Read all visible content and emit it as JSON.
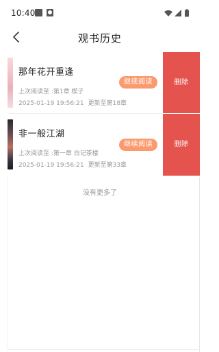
{
  "status_bar": {
    "time": "10:40"
  },
  "header": {
    "title": "观书历史"
  },
  "history": [
    {
      "title": "那年花开重逢",
      "last_read": "上次阅读至 :第1章  楔子",
      "time": "2025-01-19 19:56:21",
      "update": "更新至第18章",
      "continue_label": "继续阅读",
      "delete_label": "删除"
    },
    {
      "title": "非一般江湖",
      "last_read": "上次阅读至 :第一章  白记茶楼",
      "time": "2025-01-19 19:56:21",
      "update": "更新至第33章",
      "continue_label": "继续阅读",
      "delete_label": "删除"
    }
  ],
  "footer": {
    "no_more": "没有更多了"
  },
  "icons": {
    "back": "chevron-left-icon",
    "wifi": "wifi-icon",
    "signal": "cell-signal-icon",
    "battery": "battery-icon"
  }
}
